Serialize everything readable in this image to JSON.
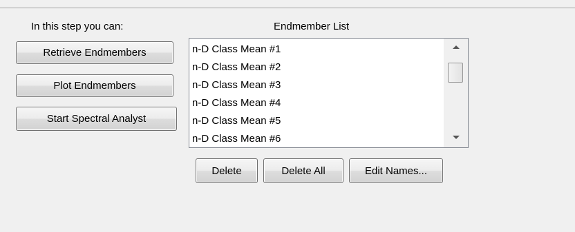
{
  "left_panel": {
    "heading": "In this step you can:",
    "buttons": [
      "Retrieve Endmembers",
      "Plot Endmembers",
      "Start Spectral Analyst"
    ]
  },
  "endmember_list": {
    "heading": "Endmember List",
    "items": [
      "n-D Class Mean #1",
      "n-D Class Mean #2",
      "n-D Class Mean #3",
      "n-D Class Mean #4",
      "n-D Class Mean #5",
      "n-D Class Mean #6"
    ],
    "actions": [
      "Delete",
      "Delete All",
      "Edit Names..."
    ]
  }
}
